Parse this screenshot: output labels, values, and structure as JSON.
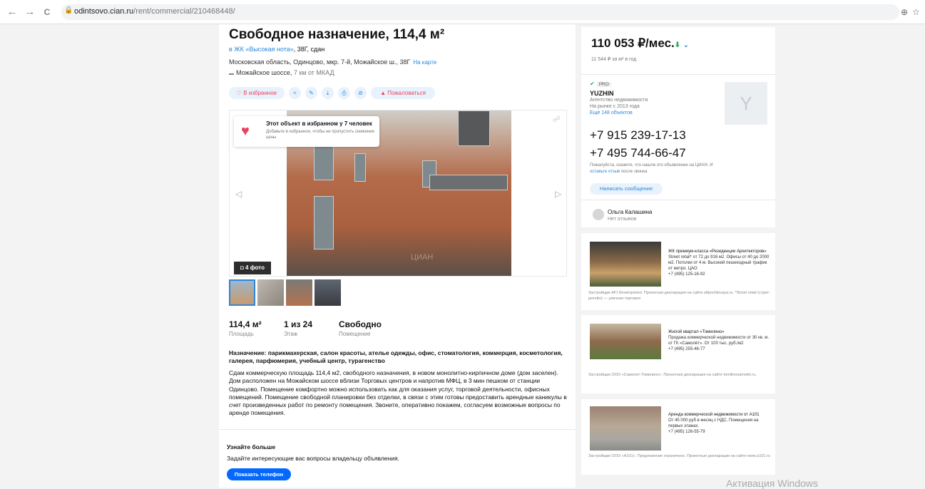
{
  "browser": {
    "url_host": "odintsovo.cian.ru",
    "url_path": "/rent/commercial/210468448/",
    "back_icon": "←",
    "forward_icon": "→",
    "reload_icon": "C",
    "lock_icon": "🔒",
    "zoom_icon": "⊕",
    "star_icon": "☆"
  },
  "listing": {
    "title": "Свободное назначение, 114,4 м²",
    "jk_link": "в ЖК «Высокая нота»",
    "jk_suffix": ", 38Г, сдан",
    "address": "Московская область, Одинцово, мкр. 7-й, Можайское ш., 38Г",
    "map_link": "На карте",
    "highway_icon": "▬",
    "highway": "Можайское шоссе,",
    "highway_distance": " 7 км от МКАД",
    "actions": {
      "favorite": "♡ В избранное",
      "share": "<",
      "edit": "✎",
      "download": "⤓",
      "print": "⎙",
      "hide": "⊘",
      "complain": "▲ Пожаловаться"
    }
  },
  "gallery": {
    "fav_heart": "♥",
    "fav_title": "Этот объект в избранном у 7 человек",
    "fav_subtitle": "Добавьте в избранное, чтобы не пропустить снижение цены",
    "prev_arrow": "◁",
    "next_arrow": "▷",
    "link_icon": "☍",
    "photo_count": "◘ 4 фото",
    "watermark": "ЦИАН"
  },
  "facts": [
    {
      "value": "114,4 м²",
      "label": "Площадь"
    },
    {
      "value": "1 из 24",
      "label": "Этаж"
    },
    {
      "value": "Свободно",
      "label": "Помещение"
    }
  ],
  "purpose": "Назначение: парикмахерская, салон красоты, ателье одежды, офис, стоматология, коммерция, косметология, галерея, парфюмерия, учебный центр, турагенство",
  "description": "Сдам коммерческую площадь 114,4 м2, свободного назначения, в новом монолитно-кирпичном доме (дом заселен). Дом расположен на Можайском шоссе вблизи Торговых центров и напротив МФЦ, в 3 мин пешком от станции Одинцово. Помещение комфортно можно использовать как для оказания услуг, торговой деятельности, офисных помещений. Помещение свободной планировки без отделки, в связи с этим готовы предоставить арендные каникулы в счет произведенных работ по ремонту помещения. Звоните, оперативно покажем, согласуем возможные вопросы по аренде помещения.",
  "learn_more": {
    "title": "Узнайте больше",
    "text": "Задайте интересующие вас вопросы владельцу объявления.",
    "button": "Показать телефон"
  },
  "sidebar": {
    "price": "110 053 ₽/мес.",
    "price_trend_icon": "⬇",
    "price_dropdown_icon": "⌄",
    "price_per_m": "11 544 ₽ за м² в год",
    "pro_check": "✔",
    "pro_label": "PRO",
    "agency_name": "YUZHIN",
    "agency_type": "Агентство недвижимости",
    "agency_since": "На рынке с 2013 года",
    "agency_more": "Ещё 148 объектов",
    "agency_logo_letter": "Y",
    "phone1": "+7 915 239-17-13",
    "phone2": "+7 495 744-66-47",
    "phone_note_1": "Пожалуйста, скажите, что нашли это объявление на ЦИАН. И ",
    "phone_note_link": "оставьте отзыв",
    "phone_note_2": " после звонка",
    "write_button": "Написать сообщение",
    "person_name": "Ольга Калашина",
    "person_reviews": "Нет отзывов"
  },
  "ads": [
    {
      "title": "ЖК премиум-класса «Резиденции Архитекторов»",
      "text": "Street retail* от 72 до 916 м2. Офисы от 40 до 2000 м2. Потолки от 4 м. Высокий пешеходный трафик от метро. ЦАО",
      "phone": "+7 (495) 125-16-92",
      "foot": "Застройщик AFI Development. Проектная декларация на сайте afipochtovaya.ru. *Street retail (стрит-ритейл) — уличная торговля"
    },
    {
      "title": "Жилой квартал «Томилино»",
      "text": "Продажа коммерческой недвижимости от 30 кв. м. от ГК «Самолёт». От 100 тыс. руб./м2",
      "phone": "+7 (495) 255-46-77",
      "foot": "Застройщик ООО «Самолет-Томилино». Проектная декларация на сайте tomilinosamolet.ru."
    },
    {
      "title": "Аренда коммерческой недвижимости от А101",
      "text": "От 45 000 руб в месяц с НДС. Помещения на первых этажах.",
      "phone": "+7 (495) 126-55-79",
      "foot": "Застройщик ООО «А101». Предложение ограничено. Проектные декларации на сайте www.a101.ru"
    }
  ],
  "os_watermark": "Активация Windows"
}
